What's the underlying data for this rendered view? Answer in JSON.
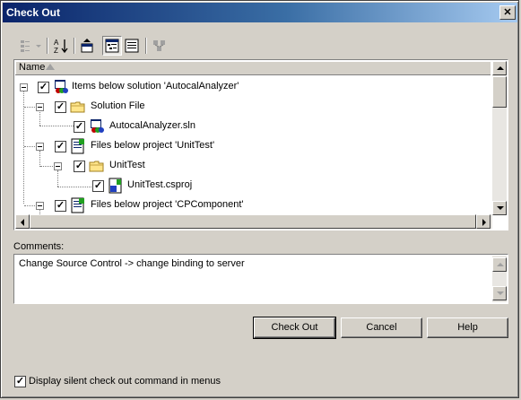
{
  "window": {
    "title": "Check Out",
    "close_glyph": "✕"
  },
  "toolbar": {
    "icons": [
      "options-icon",
      "sort-az-icon",
      "move-up-icon",
      "tree-view-icon",
      "list-view-icon",
      "network-icon"
    ]
  },
  "tree": {
    "column_header": "Name",
    "items": [
      {
        "label": "Items below solution 'AutocalAnalyzer'",
        "checked": true,
        "expanded": true,
        "icon": "solution-icon"
      },
      {
        "label": "Solution File",
        "checked": true,
        "expanded": true,
        "icon": "folder-icon"
      },
      {
        "label": "AutocalAnalyzer.sln",
        "checked": true,
        "icon": "solution-icon"
      },
      {
        "label": "Files below project 'UnitTest'",
        "checked": true,
        "expanded": true,
        "icon": "project-icon"
      },
      {
        "label": "UnitTest",
        "checked": true,
        "expanded": true,
        "icon": "folder-icon"
      },
      {
        "label": "UnitTest.csproj",
        "checked": true,
        "icon": "csproj-icon"
      },
      {
        "label": "Files below project 'CPComponent'",
        "checked": true,
        "expanded": true,
        "icon": "project-icon"
      }
    ]
  },
  "comments": {
    "label": "Comments:",
    "value": "Change Source Control -> change binding to server"
  },
  "buttons": {
    "check_out": "Check Out",
    "cancel": "Cancel",
    "help": "Help"
  },
  "options": {
    "display_silent_label": "Display silent check out command in menus",
    "display_silent_checked": true
  },
  "colors": {
    "title_start": "#0a246a",
    "title_end": "#a6caf0",
    "face": "#d4d0c8"
  }
}
